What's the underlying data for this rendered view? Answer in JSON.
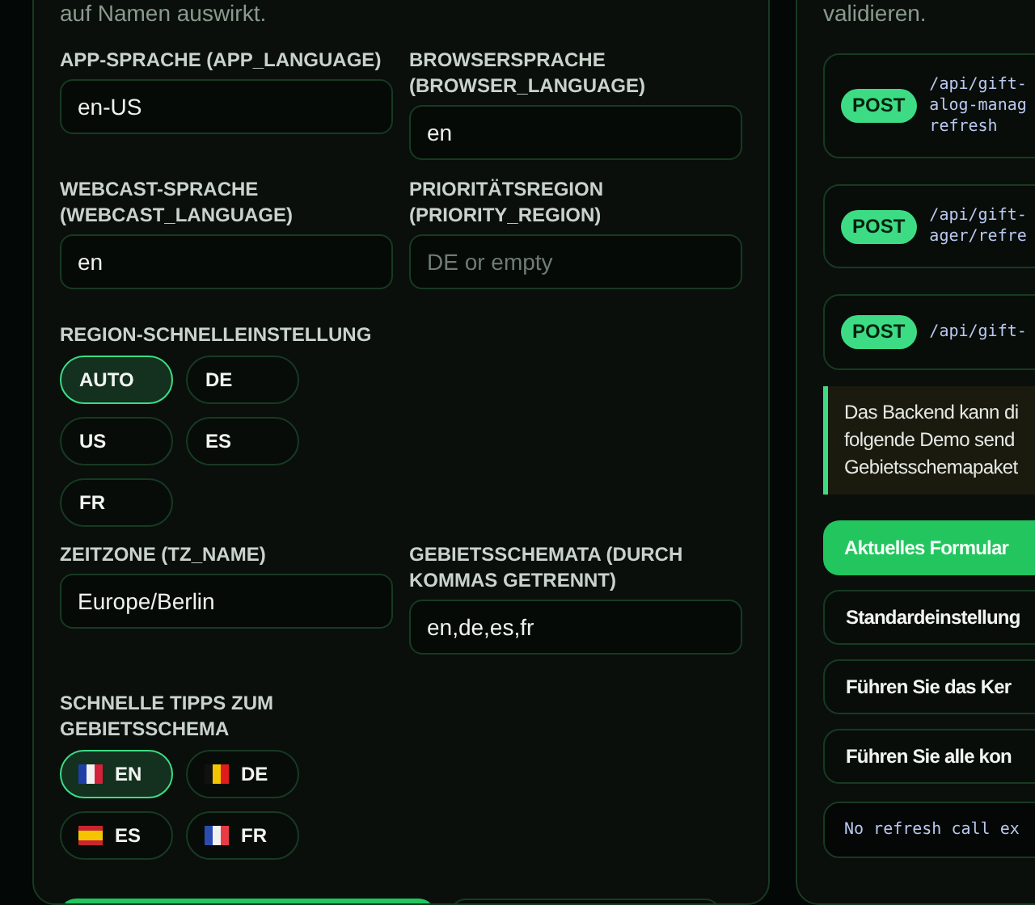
{
  "left_panel": {
    "intro_text": "auf Namen auswirkt.",
    "fields_top": [
      {
        "label": "APP-SPRACHE (APP_LANGUAGE)",
        "value": "en-US"
      },
      {
        "label": "BROWSERSPRACHE (BROWSER_LANGUAGE)",
        "value": "en"
      },
      {
        "label": "WEBCAST-SPRACHE (WEBCAST_LANGUAGE)",
        "value": "en"
      },
      {
        "label": "PRIORITÄTSREGION (PRIORITY_REGION)",
        "placeholder": "DE or empty"
      }
    ],
    "region_quick": {
      "label": "REGION-SCHNELLEINSTELLUNG",
      "options": [
        {
          "label": "AUTO",
          "selected": true
        },
        {
          "label": "DE",
          "selected": false
        },
        {
          "label": "US",
          "selected": false
        },
        {
          "label": "ES",
          "selected": false
        },
        {
          "label": "FR",
          "selected": false
        }
      ]
    },
    "fields_bottom": [
      {
        "label": "ZEITZONE (TZ_NAME)",
        "value": "Europe/Berlin"
      },
      {
        "label": "GEBIETSSCHEMATA (DURCH KOMMAS GETRENNT)",
        "value": "en,de,es,fr"
      }
    ],
    "locale_tips": {
      "label": "SCHNELLE TIPPS ZUM GEBIETSSCHEMA",
      "options": [
        {
          "label": "EN",
          "selected": true
        },
        {
          "label": "DE",
          "selected": false
        },
        {
          "label": "ES",
          "selected": false
        },
        {
          "label": "FR",
          "selected": false
        }
      ]
    },
    "bottom_buttons": [
      {
        "kind": "primary"
      },
      {
        "kind": "secondary"
      }
    ]
  },
  "right_panel": {
    "intro_text": "validieren.",
    "endpoints": [
      {
        "method": "POST",
        "path_lines": [
          "/api/gift-",
          "alog-manag",
          "refresh"
        ]
      },
      {
        "method": "POST",
        "path_lines": [
          "/api/gift-",
          "ager/refre"
        ]
      },
      {
        "method": "POST",
        "path_lines": [
          "/api/gift-"
        ]
      }
    ],
    "note_lines": [
      "Das Backend kann di",
      "folgende Demo send",
      "Gebietsschemapaket"
    ],
    "actions": [
      {
        "label": "Aktuelles Formular",
        "kind": "primary"
      },
      {
        "label": "Standardeinstellung",
        "kind": "secondary"
      },
      {
        "label": "Führen Sie das Ker",
        "kind": "secondary"
      },
      {
        "label": "Führen Sie alle kon",
        "kind": "secondary"
      }
    ],
    "output_text": "No refresh call ex"
  }
}
